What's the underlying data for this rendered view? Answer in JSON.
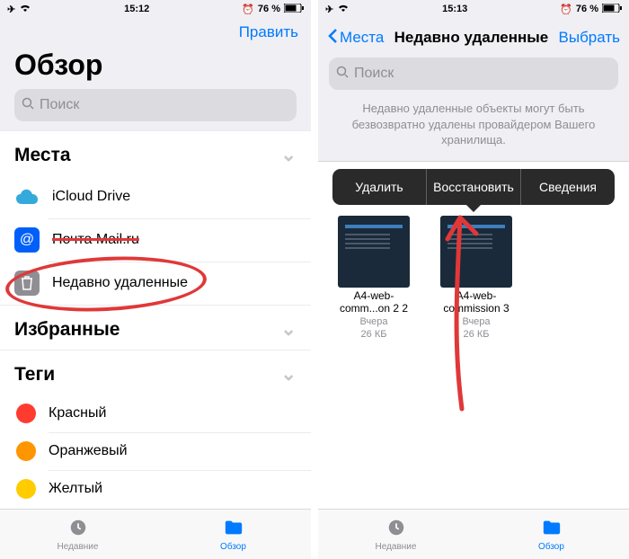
{
  "left": {
    "status": {
      "time": "15:12",
      "battery": "76 %"
    },
    "edit": "Править",
    "title": "Обзор",
    "search_placeholder": "Поиск",
    "sections": {
      "places": "Места",
      "favorites": "Избранные",
      "tags": "Теги"
    },
    "places": [
      {
        "label": "iCloud Drive"
      },
      {
        "label": "Почта Mail.ru"
      },
      {
        "label": "Недавно удаленные"
      }
    ],
    "tags": [
      {
        "label": "Красный",
        "color": "#ff3b30"
      },
      {
        "label": "Оранжевый",
        "color": "#ff9500"
      },
      {
        "label": "Желтый",
        "color": "#ffcc00"
      }
    ],
    "tabs": {
      "recents": "Недавние",
      "browse": "Обзор"
    }
  },
  "right": {
    "status": {
      "time": "15:13",
      "battery": "76 %"
    },
    "back": "Места",
    "title": "Недавно удаленные",
    "select": "Выбрать",
    "search_placeholder": "Поиск",
    "banner": "Недавно удаленные объекты могут быть безвозвратно удалены провайдером Вашего хранилища.",
    "popover": {
      "delete": "Удалить",
      "restore": "Восстановить",
      "info": "Сведения"
    },
    "files": [
      {
        "name": "A4-web-comm...on 2 2",
        "date": "Вчера",
        "size": "26 КБ"
      },
      {
        "name": "A4-web-commission 3",
        "date": "Вчера",
        "size": "26 КБ"
      }
    ],
    "tabs": {
      "recents": "Недавние",
      "browse": "Обзор"
    }
  }
}
